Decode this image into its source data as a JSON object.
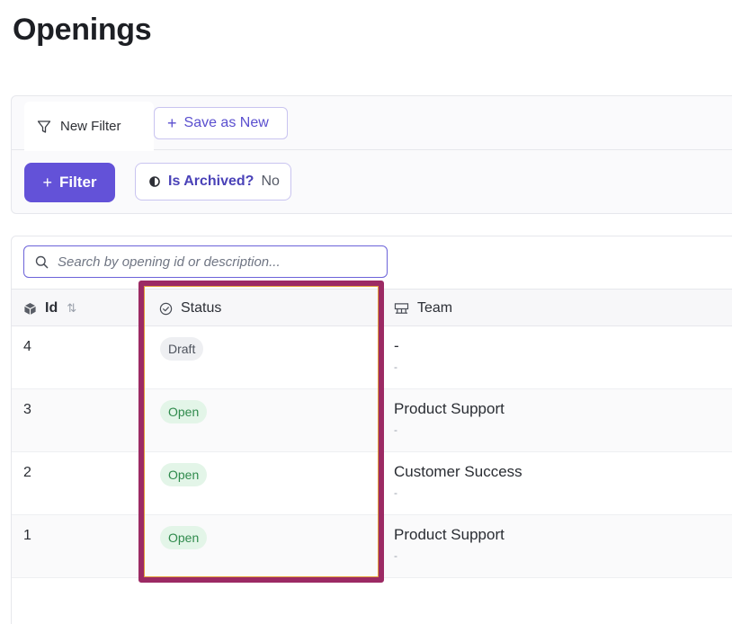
{
  "page": {
    "title": "Openings"
  },
  "filters": {
    "tab_label": "New Filter",
    "save_as_new_label": "Save as New",
    "filter_button_label": "Filter",
    "archived_chip": {
      "label": "Is Archived?",
      "value": "No"
    }
  },
  "search": {
    "placeholder": "Search by opening id or description..."
  },
  "table": {
    "columns": {
      "id": "Id",
      "status": "Status",
      "team": "Team"
    },
    "rows": [
      {
        "id": "4",
        "status": "Draft",
        "team": "-",
        "sub": "-"
      },
      {
        "id": "3",
        "status": "Open",
        "team": "Product Support",
        "sub": "-"
      },
      {
        "id": "2",
        "status": "Open",
        "team": "Customer Success",
        "sub": "-"
      },
      {
        "id": "1",
        "status": "Open",
        "team": "Product Support",
        "sub": "-"
      }
    ]
  },
  "colors": {
    "accent": "#6352d8",
    "highlight": "#9c2a64",
    "open_badge_bg": "#e3f5e8",
    "open_badge_text": "#2f8a4c",
    "draft_badge_bg": "#eeeff2"
  },
  "icons": {
    "tab": "funnel-icon",
    "chip": "half-circle-icon",
    "search": "search-icon",
    "id_column": "cube-icon",
    "status_column": "check-circle-icon",
    "team_column": "team-icon",
    "sort": "sort-arrows-icon"
  }
}
